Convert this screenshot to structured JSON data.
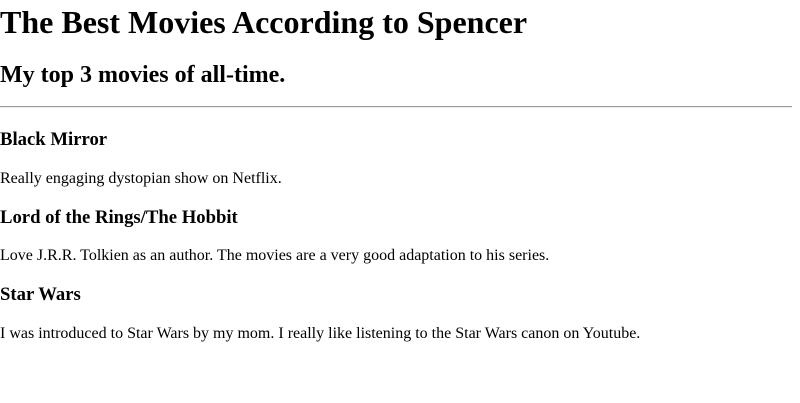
{
  "page": {
    "title": "The Best Movies According to Spencer",
    "subtitle": "My top 3 movies of all-time."
  },
  "movies": [
    {
      "title": "Black Mirror",
      "description": "Really engaging dystopian show on Netflix."
    },
    {
      "title": "Lord of the Rings/The Hobbit",
      "description": "Love J.R.R. Tolkien as an author. The movies are a very good adaptation to his series."
    },
    {
      "title": "Star Wars",
      "description": "I was introduced to Star Wars by my mom. I really like listening to the Star Wars canon on Youtube."
    }
  ]
}
